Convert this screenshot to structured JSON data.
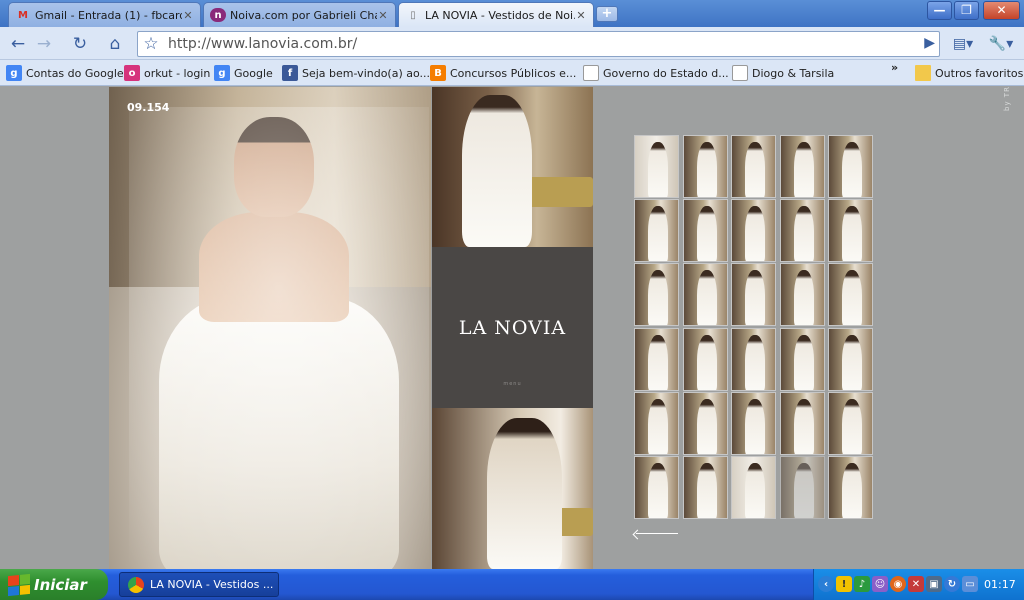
{
  "browser": {
    "tabs": [
      {
        "label": "Gmail - Entrada (1) - fbcard...",
        "icon": "gmail-icon"
      },
      {
        "label": "Noiva.com por Gabrieli Cha...",
        "icon": "noiva-icon"
      },
      {
        "label": "LA NOVIA - Vestidos de Noi...",
        "icon": "page-icon"
      }
    ],
    "new_tab": "+",
    "window_buttons": {
      "minimize": "—",
      "restore": "❐",
      "close": "✕"
    },
    "url": "http://www.lanovia.com.br/"
  },
  "bookmarks": [
    {
      "label": "Contas do Google",
      "icon": "google-icon"
    },
    {
      "label": "orkut - login",
      "icon": "orkut-icon"
    },
    {
      "label": "Google",
      "icon": "google-icon"
    },
    {
      "label": "Seja bem-vindo(a) ao...",
      "icon": "facebook-icon"
    },
    {
      "label": "Concursos Públicos e...",
      "icon": "blogger-icon"
    },
    {
      "label": "Governo do Estado d...",
      "icon": "page-icon"
    },
    {
      "label": "Diogo & Tarsila",
      "icon": "page-icon"
    }
  ],
  "bookmarks_overflow": "»",
  "other_favorites": "Outros favoritos",
  "page": {
    "model_number": "09.154",
    "logo": "LA NOVIA",
    "menu_label": "menu",
    "byline": "by TRUFE"
  },
  "taskbar": {
    "start_label": "Iniciar",
    "active_task": "LA NOVIA - Vestidos ...",
    "clock": "01:17"
  },
  "colors": {
    "page_background": "#9ea0a0",
    "logo_panel": "#4a4745",
    "chrome_frame": "#dbe6f6",
    "taskbar": "#245edc",
    "start_button": "#2f8f2f"
  }
}
